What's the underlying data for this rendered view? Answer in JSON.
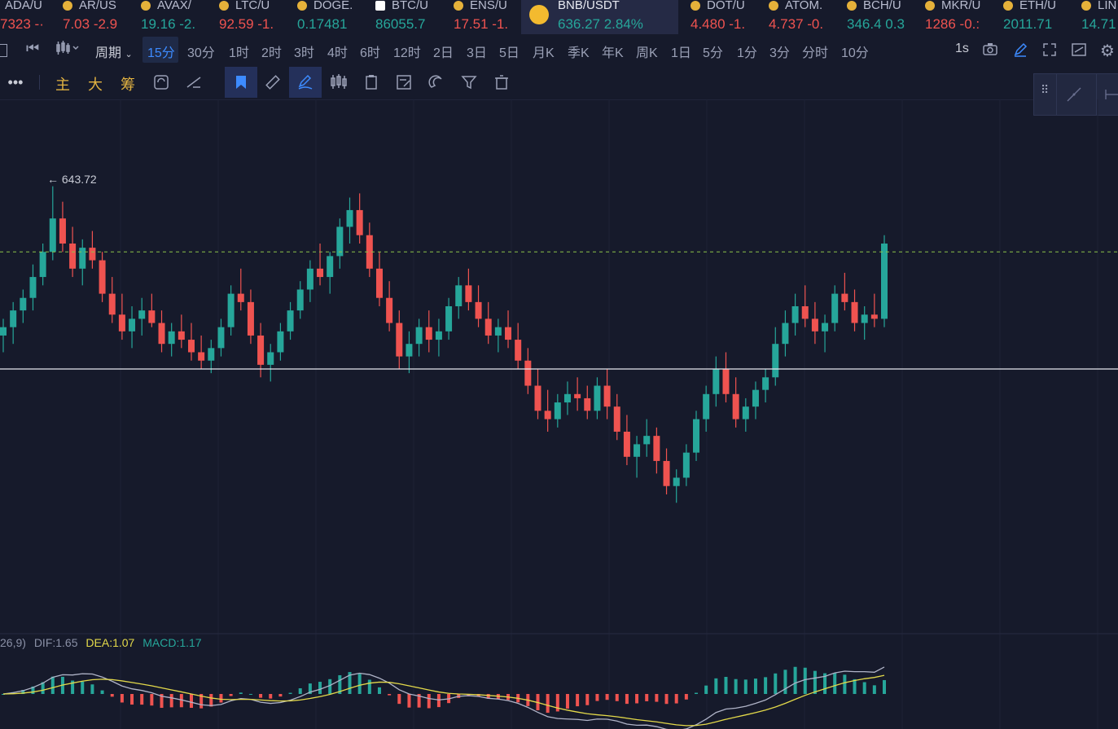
{
  "tickers": [
    {
      "symbol": "ADA/U",
      "price": "7323",
      "change": "-·",
      "dir": "down",
      "icon": "coin-icon"
    },
    {
      "symbol": "AR/US",
      "price": "7.03",
      "change": "-2.9",
      "dir": "down",
      "icon": "coin-icon"
    },
    {
      "symbol": "AVAX/",
      "price": "19.16",
      "change": "-2.",
      "dir": "up",
      "icon": "coin-icon"
    },
    {
      "symbol": "LTC/U",
      "price": "92.59",
      "change": "-1.",
      "dir": "down",
      "icon": "coin-icon"
    },
    {
      "symbol": "DOGE.",
      "price": "0.17481",
      "change": "",
      "dir": "up",
      "icon": "coin-icon"
    },
    {
      "symbol": "BTC/U",
      "price": "86055.7",
      "change": "",
      "dir": "up",
      "icon": "btc-icon"
    },
    {
      "symbol": "ENS/U",
      "price": "17.51",
      "change": "-1.",
      "dir": "down",
      "icon": "coin-icon"
    },
    {
      "symbol": "BNB/USDT",
      "price": "636.27",
      "change": "2.84%",
      "dir": "up",
      "icon": "bnb-icon"
    },
    {
      "symbol": "DOT/U",
      "price": "4.480",
      "change": "-1.",
      "dir": "down",
      "icon": "coin-icon"
    },
    {
      "symbol": "ATOM.",
      "price": "4.737",
      "change": "-0.",
      "dir": "down",
      "icon": "coin-icon"
    },
    {
      "symbol": "BCH/U",
      "price": "346.4",
      "change": "0.3",
      "dir": "up",
      "icon": "coin-icon"
    },
    {
      "symbol": "MKR/U",
      "price": "1286",
      "change": "-0.:",
      "dir": "down",
      "icon": "coin-icon"
    },
    {
      "symbol": "ETH/U",
      "price": "2011.71",
      "change": "",
      "dir": "up",
      "icon": "coin-icon"
    },
    {
      "symbol": "LIN",
      "price": "14.71",
      "change": "",
      "dir": "up",
      "icon": "coin-icon"
    }
  ],
  "period_bar": {
    "cycle_label": "周期",
    "periods": [
      "15分",
      "30分",
      "1时",
      "2时",
      "3时",
      "4时",
      "6时",
      "12时",
      "2日",
      "3日",
      "5日",
      "月K",
      "季K",
      "年K",
      "周K",
      "1日",
      "5分",
      "1分",
      "3分",
      "分时",
      "10分"
    ],
    "selected": "15分",
    "right_label": "1s"
  },
  "tool_bar": {
    "labels": [
      "主",
      "大",
      "筹"
    ]
  },
  "chart_data": {
    "type": "candlestick",
    "symbol": "BNB/USDT",
    "interval": "15分",
    "high_marker": "643.72",
    "reference_lines": {
      "dashed_green": true,
      "solid_white": true
    },
    "candles_note": "Approximate OHLC reading; y axis scale not printed",
    "candles": [
      [
        608,
        612,
        604,
        610
      ],
      [
        610,
        616,
        606,
        614
      ],
      [
        614,
        619,
        611,
        617
      ],
      [
        617,
        625,
        614,
        622
      ],
      [
        622,
        630,
        620,
        628
      ],
      [
        628,
        643.7,
        626,
        636
      ],
      [
        636,
        640,
        628,
        630
      ],
      [
        630,
        634,
        622,
        624
      ],
      [
        624,
        631,
        620,
        629
      ],
      [
        629,
        633,
        624,
        626
      ],
      [
        626,
        628,
        616,
        618
      ],
      [
        618,
        622,
        611,
        613
      ],
      [
        613,
        618,
        607,
        609
      ],
      [
        609,
        615,
        605,
        612
      ],
      [
        612,
        617,
        608,
        614
      ],
      [
        614,
        618,
        610,
        611
      ],
      [
        611,
        614,
        604,
        606
      ],
      [
        606,
        611,
        603,
        609
      ],
      [
        609,
        613,
        605,
        607
      ],
      [
        607,
        611,
        602,
        604
      ],
      [
        604,
        608,
        600,
        602
      ],
      [
        602,
        607,
        599,
        605
      ],
      [
        605,
        612,
        603,
        610
      ],
      [
        610,
        620,
        608,
        618
      ],
      [
        618,
        624,
        614,
        616
      ],
      [
        616,
        619,
        606,
        608
      ],
      [
        608,
        611,
        598,
        601
      ],
      [
        601,
        606,
        597,
        604
      ],
      [
        604,
        611,
        602,
        609
      ],
      [
        609,
        616,
        607,
        614
      ],
      [
        614,
        621,
        612,
        619
      ],
      [
        619,
        626,
        616,
        624
      ],
      [
        624,
        630,
        620,
        622
      ],
      [
        622,
        628,
        618,
        627
      ],
      [
        627,
        636,
        624,
        634
      ],
      [
        634,
        641,
        630,
        638
      ],
      [
        638,
        642,
        630,
        632
      ],
      [
        632,
        635,
        622,
        624
      ],
      [
        624,
        628,
        615,
        617
      ],
      [
        617,
        621,
        609,
        611
      ],
      [
        611,
        614,
        600,
        603
      ],
      [
        603,
        609,
        599,
        606
      ],
      [
        606,
        612,
        603,
        610
      ],
      [
        610,
        614,
        604,
        607
      ],
      [
        607,
        612,
        603,
        609
      ],
      [
        609,
        617,
        607,
        615
      ],
      [
        615,
        622,
        612,
        620
      ],
      [
        620,
        624,
        614,
        616
      ],
      [
        616,
        620,
        610,
        612
      ],
      [
        612,
        616,
        606,
        608
      ],
      [
        608,
        612,
        604,
        610
      ],
      [
        610,
        614,
        605,
        607
      ],
      [
        607,
        611,
        600,
        602
      ],
      [
        602,
        605,
        594,
        596
      ],
      [
        596,
        600,
        588,
        590
      ],
      [
        590,
        595,
        585,
        588
      ],
      [
        588,
        594,
        586,
        592
      ],
      [
        592,
        597,
        589,
        594
      ],
      [
        594,
        598,
        590,
        593
      ],
      [
        593,
        596,
        588,
        590
      ],
      [
        590,
        598,
        588,
        596
      ],
      [
        596,
        600,
        588,
        591
      ],
      [
        591,
        594,
        583,
        585
      ],
      [
        585,
        589,
        577,
        579
      ],
      [
        579,
        584,
        574,
        582
      ],
      [
        582,
        588,
        579,
        584
      ],
      [
        584,
        586,
        575,
        578
      ],
      [
        578,
        581,
        570,
        572
      ],
      [
        572,
        576,
        568,
        574
      ],
      [
        574,
        582,
        572,
        580
      ],
      [
        580,
        590,
        578,
        588
      ],
      [
        588,
        596,
        585,
        594
      ],
      [
        594,
        603,
        591,
        600
      ],
      [
        600,
        604,
        592,
        594
      ],
      [
        594,
        598,
        586,
        588
      ],
      [
        588,
        593,
        585,
        591
      ],
      [
        591,
        597,
        588,
        595
      ],
      [
        595,
        600,
        592,
        598
      ],
      [
        598,
        610,
        596,
        606
      ],
      [
        606,
        614,
        603,
        611
      ],
      [
        611,
        618,
        608,
        615
      ],
      [
        615,
        620,
        610,
        612
      ],
      [
        612,
        616,
        606,
        609
      ],
      [
        609,
        613,
        604,
        611
      ],
      [
        611,
        620,
        609,
        618
      ],
      [
        618,
        623,
        614,
        616
      ],
      [
        616,
        619,
        609,
        611
      ],
      [
        611,
        615,
        607,
        613
      ],
      [
        613,
        618,
        610,
        612
      ],
      [
        612,
        632,
        610,
        630
      ]
    ]
  },
  "macd": {
    "label": "26,9)",
    "dif_label": "DIF:1.65",
    "dea_label": "DEA:1.07",
    "macd_label": "MACD:1.17"
  }
}
